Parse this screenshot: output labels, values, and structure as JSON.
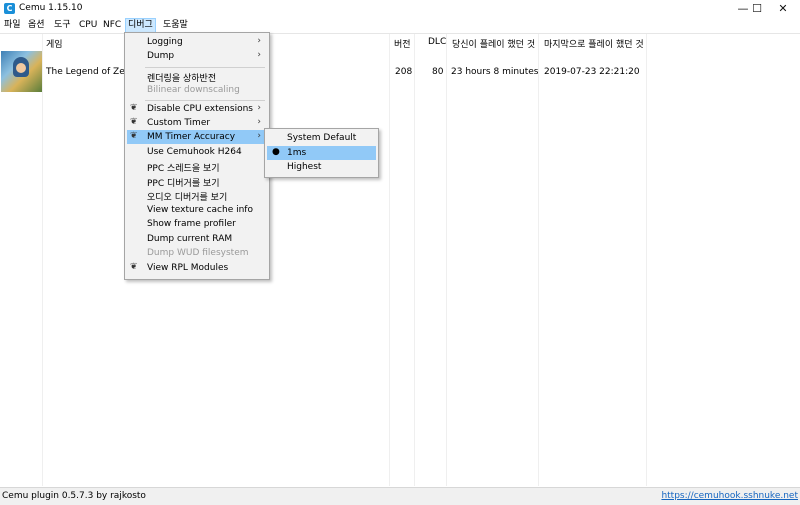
{
  "window": {
    "title": "Cemu 1.15.10",
    "app_icon_glyph": "C",
    "min_glyph": "—",
    "max_glyph": "☐",
    "close_glyph": "✕"
  },
  "menubar": [
    "파일",
    "옵션",
    "도구",
    "CPU",
    "NFC",
    "디버그",
    "도움말"
  ],
  "columns": {
    "game": "게임",
    "version": "버전",
    "dlc": "DLC",
    "played": "당신이 플레이 했던 것",
    "last_played": "마지막으로 플레이 했던 것"
  },
  "games": [
    {
      "name": "The Legend of Zelda",
      "version": "208",
      "dlc": "80",
      "played": "23 hours 8 minutes",
      "last_played": "2019-07-23 22:21:20"
    }
  ],
  "debug_menu": [
    {
      "label": "Logging",
      "arrow": "›"
    },
    {
      "label": "Dump",
      "arrow": "›"
    },
    {
      "label": "렌더링을 상하반전"
    },
    {
      "label": "Bilinear downscaling",
      "disabled": true
    },
    {
      "label": "Disable CPU extensions",
      "arrow": "›"
    },
    {
      "label": "Custom Timer",
      "arrow": "›"
    },
    {
      "label": "MM Timer Accuracy",
      "arrow": "›"
    },
    {
      "label": "Use Cemuhook H264"
    },
    {
      "label": "PPC 스레드을 보기"
    },
    {
      "label": "PPC 디버거를 보기"
    },
    {
      "label": "오디오 디버거를 보기"
    },
    {
      "label": "View texture cache info"
    },
    {
      "label": "Show frame profiler"
    },
    {
      "label": "Dump current RAM"
    },
    {
      "label": "Dump WUD filesystem",
      "disabled": true
    },
    {
      "label": "View RPL Modules"
    }
  ],
  "timer_submenu": [
    {
      "label": "System Default"
    },
    {
      "label": "1ms",
      "selected": true,
      "bullet": "●"
    },
    {
      "label": "Highest"
    }
  ],
  "statusbar": {
    "left": "Cemu plugin 0.5.7.3 by rajkosto",
    "link": "https://cemuhook.sshnuke.net"
  }
}
